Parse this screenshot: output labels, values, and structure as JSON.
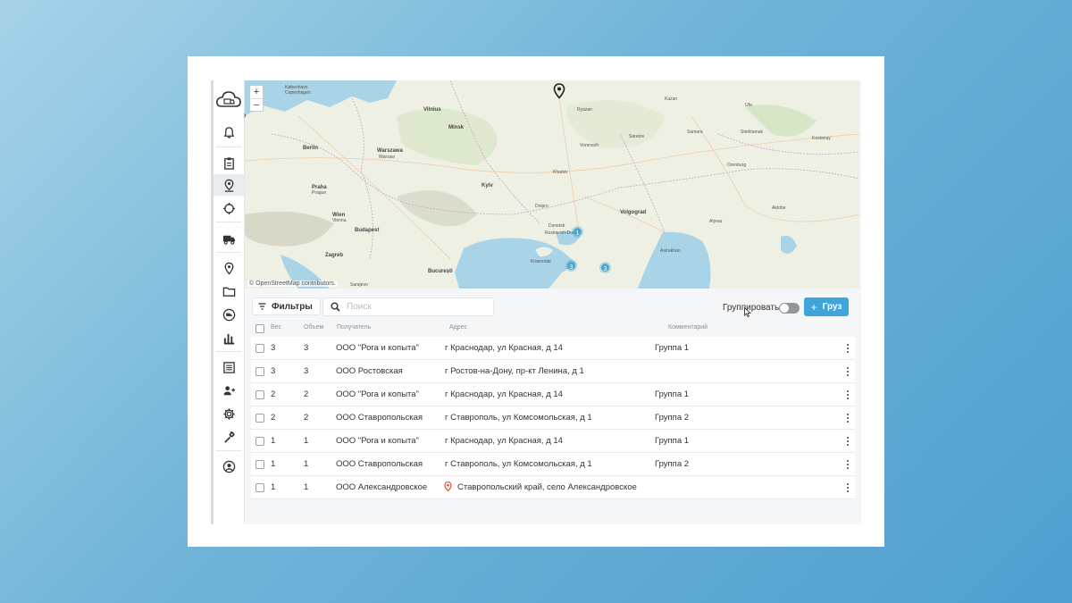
{
  "map": {
    "attribution": "© OpenStreetMap contributors.",
    "zoom_in": "+",
    "zoom_out": "−",
    "cities": [
      {
        "name": "København",
        "big": true
      },
      {
        "name": "Copenhagen",
        "big": false
      },
      {
        "name": "Vilnius",
        "big": true
      },
      {
        "name": "Minsk",
        "big": true
      },
      {
        "name": "Berlin",
        "big": true
      },
      {
        "name": "Warszawa",
        "big": true
      },
      {
        "name": "Warsaw",
        "big": false
      },
      {
        "name": "Praha",
        "big": true
      },
      {
        "name": "Prague",
        "big": false
      },
      {
        "name": "Kyiv",
        "big": true
      },
      {
        "name": "Wien",
        "big": true
      },
      {
        "name": "Vienna",
        "big": false
      },
      {
        "name": "Budapest",
        "big": true
      },
      {
        "name": "Zagreb",
        "big": true
      },
      {
        "name": "București",
        "big": true
      },
      {
        "name": "Sarajevo",
        "big": false
      },
      {
        "name": "Kharkiv",
        "big": false
      },
      {
        "name": "Ryazan",
        "big": false
      },
      {
        "name": "Voronezh",
        "big": false
      },
      {
        "name": "Saratov",
        "big": false
      },
      {
        "name": "Volgograd",
        "big": true
      },
      {
        "name": "Rostov-on-Don",
        "big": false
      },
      {
        "name": "Krasnodar",
        "big": false
      },
      {
        "name": "Samara",
        "big": false
      },
      {
        "name": "Orenburg",
        "big": false
      },
      {
        "name": "Ufa",
        "big": false
      },
      {
        "name": "Kazan",
        "big": false
      },
      {
        "name": "Astrakhan",
        "big": false
      },
      {
        "name": "Aktobe",
        "big": false
      },
      {
        "name": "Atyrau",
        "big": false
      },
      {
        "name": "Sterlitamak",
        "big": false
      },
      {
        "name": "Kostanay",
        "big": false
      },
      {
        "name": "Donetsk",
        "big": false
      },
      {
        "name": "Dnipro",
        "big": false
      }
    ],
    "clusters": [
      "1",
      "3",
      "3"
    ]
  },
  "toolbar": {
    "filters_label": "Фильтры",
    "search_placeholder": "Поиск",
    "group_label": "Группировать",
    "add_label": "Груз"
  },
  "table": {
    "columns": {
      "weight": "Вес",
      "volume": "Объем",
      "recipient": "Получатель",
      "address": "Адрес",
      "comment": "Комментарий"
    },
    "rows": [
      {
        "weight": "3",
        "volume": "3",
        "recipient": "ООО \"Рога и копыта\"",
        "address": "г Краснодар, ул Красная, д 14",
        "comment": "Группа 1"
      },
      {
        "weight": "3",
        "volume": "3",
        "recipient": "ООО Ростовская",
        "address": "г Ростов-на-Дону, пр-кт Ленина, д 1",
        "comment": ""
      },
      {
        "weight": "2",
        "volume": "2",
        "recipient": "ООО \"Рога и копыта\"",
        "address": "г Краснодар, ул Красная, д 14",
        "comment": "Группа 1"
      },
      {
        "weight": "2",
        "volume": "2",
        "recipient": "ООО Ставропольская",
        "address": "г Ставрополь, ул Комсомольская, д 1",
        "comment": "Группа 2"
      },
      {
        "weight": "1",
        "volume": "1",
        "recipient": "ООО \"Рога и копыта\"",
        "address": "г Краснодар, ул Красная, д 14",
        "comment": "Группа 1"
      },
      {
        "weight": "1",
        "volume": "1",
        "recipient": "ООО Ставропольская",
        "address": "г Ставрополь, ул Комсомольская, д 1",
        "comment": "Группа 2"
      },
      {
        "weight": "1",
        "volume": "1",
        "recipient": "ООО Александровское",
        "address": "Ставропольский край, село Александровское",
        "comment": "",
        "has_pin": true
      }
    ]
  },
  "sidebar": {
    "icons": [
      "cloud-truck-logo-icon",
      "bell-icon",
      "clipboard-icon",
      "map-pin-icon",
      "crosshair-icon",
      "truck-icon",
      "location-icon",
      "folder-icon",
      "delivery-icon",
      "bar-chart-icon",
      "list-icon",
      "users-icon",
      "gear-icon",
      "wrench-icon",
      "user-circle-icon"
    ]
  },
  "colors": {
    "accent": "#3fa4dc",
    "cluster": "#45a6d8",
    "sea": "#a9d3e6",
    "background": "#6fb3d8"
  }
}
